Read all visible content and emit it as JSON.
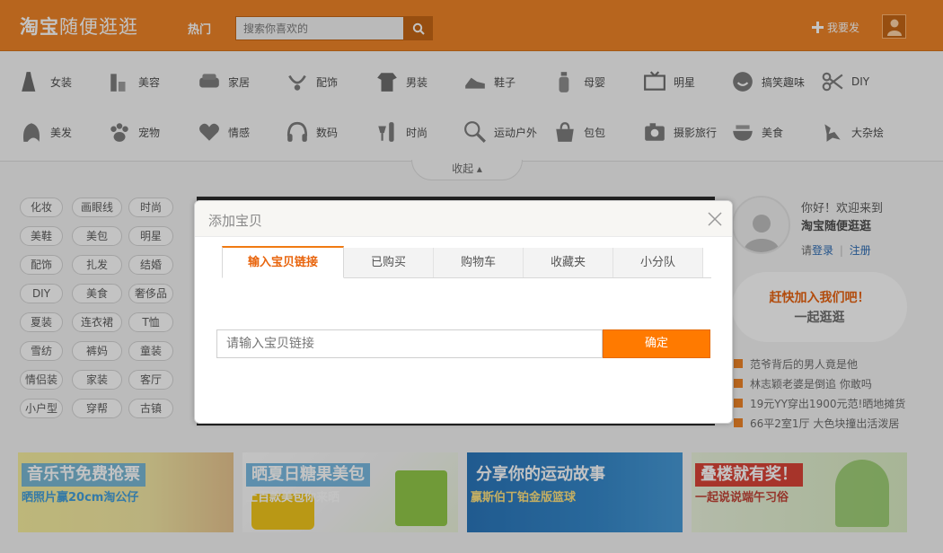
{
  "header": {
    "logo_brand": "淘宝",
    "logo_suffix": "随便逛逛",
    "hot_label": "热门",
    "search_placeholder": "搜索你喜欢的",
    "publish_label": "我要发"
  },
  "categories": [
    {
      "label": "女装",
      "icon": "dress-icon"
    },
    {
      "label": "美容",
      "icon": "cosmetics-icon"
    },
    {
      "label": "家居",
      "icon": "sofa-icon"
    },
    {
      "label": "配饰",
      "icon": "accessory-icon"
    },
    {
      "label": "男装",
      "icon": "shirt-icon"
    },
    {
      "label": "鞋子",
      "icon": "shoe-icon"
    },
    {
      "label": "母婴",
      "icon": "baby-bottle-icon"
    },
    {
      "label": "明星",
      "icon": "tv-icon"
    },
    {
      "label": "搞笑趣味",
      "icon": "smile-icon"
    },
    {
      "label": "DIY",
      "icon": "scissors-icon"
    },
    {
      "label": "美发",
      "icon": "hair-icon"
    },
    {
      "label": "宠物",
      "icon": "paw-icon"
    },
    {
      "label": "情感",
      "icon": "heart-icon"
    },
    {
      "label": "数码",
      "icon": "headphones-icon"
    },
    {
      "label": "时尚",
      "icon": "wine-icon"
    },
    {
      "label": "运动户外",
      "icon": "racket-icon"
    },
    {
      "label": "包包",
      "icon": "bag-icon"
    },
    {
      "label": "摄影旅行",
      "icon": "camera-icon"
    },
    {
      "label": "美食",
      "icon": "bowl-icon"
    },
    {
      "label": "大杂烩",
      "icon": "misc-icon"
    }
  ],
  "collapse_label": "收起",
  "tags": [
    "化妆",
    "画眼线",
    "时尚",
    "美鞋",
    "美包",
    "明星",
    "配饰",
    "扎发",
    "结婚",
    "DIY",
    "美食",
    "奢侈品",
    "夏装",
    "连衣裙",
    "T恤",
    "雪纺",
    "裤妈",
    "童装",
    "情侣装",
    "家装",
    "客厅",
    "小户型",
    "穿帮",
    "古镇"
  ],
  "user_panel": {
    "hello": "你好！欢迎来到",
    "site_name": "淘宝随便逛逛",
    "please": "请",
    "login": "登录",
    "separator": "|",
    "register": "注册",
    "join_line1": "赶快加入我们吧！",
    "join_line2": "一起逛逛"
  },
  "news": [
    "范爷背后的男人竟是他",
    "林志颖老婆是倒追 你敢吗",
    "19元YY穿出1900元范!晒地摊货",
    "66平2室1厅 大色块撞出活泼居"
  ],
  "banners": [
    {
      "title": "音乐节免费抢票",
      "subtitle": "晒照片赢20cm淘公仔"
    },
    {
      "title": "晒夏日糖果美包",
      "subtitle": "上百款美包你来晒"
    },
    {
      "title": "分享你的运动故事",
      "subtitle": "赢斯伯丁铂金版篮球"
    },
    {
      "title": "叠楼就有奖！",
      "subtitle": "一起说说端午习俗"
    }
  ],
  "modal": {
    "title": "添加宝贝",
    "tabs": [
      "输入宝贝链接",
      "已购买",
      "购物车",
      "收藏夹",
      "小分队"
    ],
    "input_placeholder": "请输入宝贝链接",
    "confirm_label": "确定"
  },
  "colors": {
    "brand_orange": "#ef7d1b",
    "confirm_orange": "#ff7a00",
    "link_blue": "#2264b0"
  }
}
